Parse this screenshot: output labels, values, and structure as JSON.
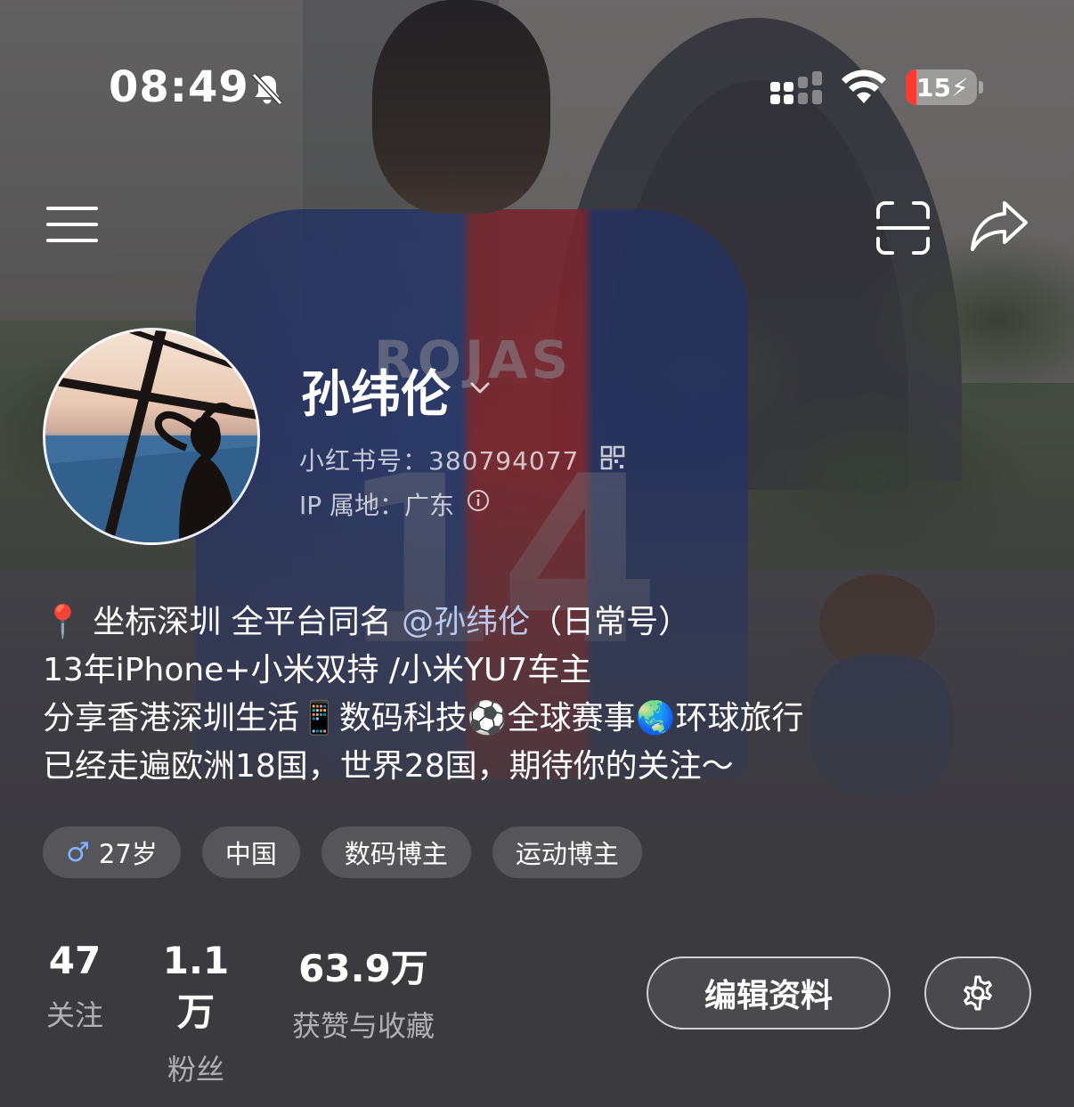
{
  "status_bar": {
    "time": "08:49",
    "bell_icon": "bell-slash-icon",
    "signal_icon": "cellular-signal-icon",
    "wifi_icon": "wifi-icon",
    "battery_level": "15",
    "battery_color": "#ff3b30"
  },
  "nav": {
    "menu_icon": "hamburger-menu-icon",
    "scan_icon": "scan-icon",
    "share_icon": "share-arrow-icon"
  },
  "profile": {
    "nickname": "孙纬伦",
    "id_line": "小红书号：380794077",
    "ip_line": "IP 属地：广东",
    "bio": {
      "line1_prefix": "📍 坐标深圳 全平台同名 ",
      "line1_mention": "@孙纬伦",
      "line1_suffix": "（日常号）",
      "line2": "13年iPhone+小米双持 /小米YU7车主",
      "line3": "分享香港深圳生活📱数码科技⚽全球赛事🌏环球旅行",
      "line4": "已经走遍欧洲18国，世界28国，期待你的关注～"
    },
    "tags": {
      "age": "27岁",
      "region": "中国",
      "tag1": "数码博主",
      "tag2": "运动博主"
    },
    "stats": {
      "following_num": "47",
      "following_label": "关注",
      "fans_num": "1.1万",
      "fans_label": "粉丝",
      "likes_num": "63.9万",
      "likes_label": "获赞与收藏"
    },
    "edit_label": "编辑资料",
    "settings_icon": "gear-icon",
    "mention_color": "#b9c8ec"
  }
}
